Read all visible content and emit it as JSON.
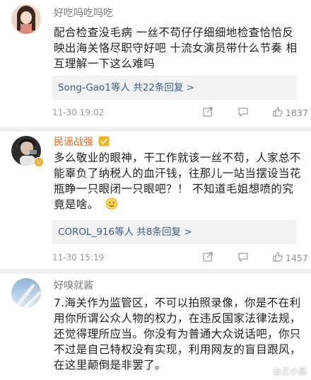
{
  "comments": [
    {
      "username": "好吃吗吃吗吃",
      "body": "配合检查没毛病 一丝不苟仔仔细细地检查恰恰反映出海关恪尽职守好吧 十流女演员带什么节奏 相互理解一下这么难吗",
      "reply_summary": "Song-Gao1等人 共22条回复 >",
      "time": "11-30 19:02",
      "likes": "1837"
    },
    {
      "username": "民谣战强",
      "body": "多么敬业的眼神，干工作就该一丝不苟，人家总不能辜负了纳税人的血汗钱，往那儿一站当摆设当花瓶睁一只眼闭一只眼吧？！ 不知道毛姐想喷的究竟是啥。",
      "reply_summary": "COROL_916等人 共8条回复 >",
      "time": "11-30 15:19",
      "likes": "1457"
    },
    {
      "username": "好嗅就酱",
      "body": "7.海关作为监管区，不可以拍照录像，你是不在利用你所谓公众人物的权力，在违反国家法律法规，还觉得理所应当。你没有为普通大众说话吧，你只不过是自己特权没有实现，利用网友的盲目跟风，在这里颠倒是非罢了。"
    }
  ],
  "watermark": "@王小暴",
  "icons": {
    "share": "share-icon",
    "reply": "comment-icon",
    "like": "thumbs-up-icon",
    "emoji": "smile-emoji-icon",
    "badge": "verified-badge-icon"
  },
  "colors": {
    "vip_name": "#e8651a",
    "link": "#3b5f86",
    "meta": "#9a9a9a",
    "reply_bg": "#f2f2f2"
  }
}
